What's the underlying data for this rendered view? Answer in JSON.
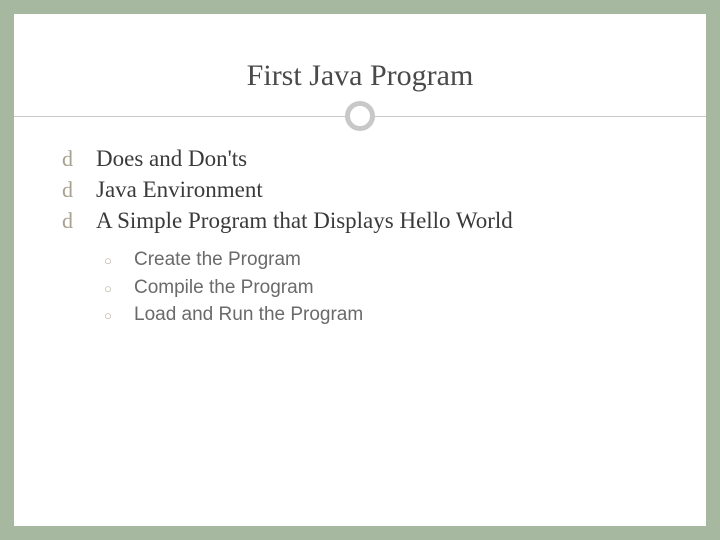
{
  "title": "First Java Program",
  "items": [
    {
      "text": "Does and Don'ts"
    },
    {
      "text": "Java Environment"
    },
    {
      "text": "A Simple Program that Displays Hello World"
    }
  ],
  "subitems": [
    {
      "text": "Create the Program"
    },
    {
      "text": "Compile the Program"
    },
    {
      "text": "Load and Run the Program"
    }
  ],
  "bullets": {
    "curl": "d",
    "ring": "○"
  }
}
